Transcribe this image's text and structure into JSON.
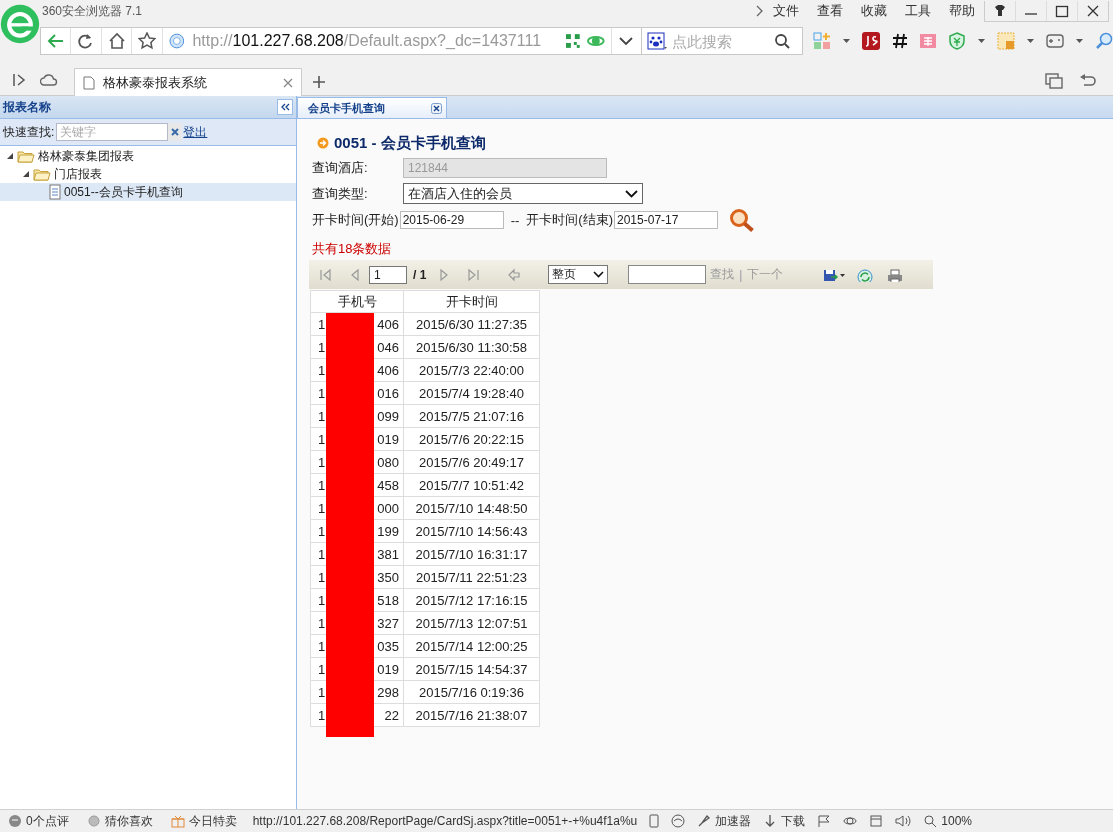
{
  "browser": {
    "title": "360安全浏览器 7.1",
    "menu": [
      "文件",
      "查看",
      "收藏",
      "工具",
      "帮助"
    ],
    "address": {
      "scheme": "http://",
      "host": "101.227.68.208",
      "path": "/Default.aspx?_dc=1437111"
    },
    "search": {
      "placeholder": "点此搜索"
    },
    "tabs": [
      {
        "label": "格林豪泰报表系统",
        "selected": true
      }
    ]
  },
  "sidebar": {
    "title": "报表名称",
    "search_label": "快速查找:",
    "search": {
      "placeholder": "关键字"
    },
    "logout": "登出",
    "tree": [
      {
        "label": "格林豪泰集团报表",
        "kind": "folder",
        "expanded": true,
        "selected": false,
        "children": [
          {
            "label": "门店报表",
            "kind": "folder",
            "expanded": true,
            "selected": false,
            "children": [
              {
                "label": "0051--会员卡手机查询",
                "kind": "report",
                "selected": true
              }
            ]
          }
        ]
      }
    ]
  },
  "report_tabs": [
    {
      "label": "会员卡手机查询",
      "selected": true
    }
  ],
  "report": {
    "title": "0051 - 会员卡手机查询",
    "fields": [
      {
        "label": "查询酒店:",
        "kind": "text",
        "value": "121844",
        "disabled": true
      },
      {
        "label": "查询类型:",
        "kind": "select",
        "value": "在酒店入住的会员",
        "disabled": false
      }
    ],
    "date_range": {
      "start_label": "开卡时间(开始)",
      "start": "2015-06-29",
      "separator": "--",
      "end_label": "开卡时间(结束)",
      "end": "2015-07-17"
    },
    "count": "共有18条数据",
    "toolbar": {
      "page": "1",
      "of": "/ 1",
      "page_mode": "整页",
      "find": "查找",
      "separator": "|",
      "next": "下一个"
    },
    "table": {
      "columns": [
        "手机号",
        "开卡时间"
      ],
      "rows": [
        {
          "phone_start": "1",
          "phone_end": "406",
          "time": "2015/6/30 11:27:35"
        },
        {
          "phone_start": "1",
          "phone_end": "046",
          "time": "2015/6/30 11:30:58"
        },
        {
          "phone_start": "1",
          "phone_end": "406",
          "time": "2015/7/3 22:40:00"
        },
        {
          "phone_start": "1",
          "phone_end": "016",
          "time": "2015/7/4 19:28:40"
        },
        {
          "phone_start": "1",
          "phone_end": "099",
          "time": "2015/7/5 21:07:16"
        },
        {
          "phone_start": "1",
          "phone_end": "019",
          "time": "2015/7/6 20:22:15"
        },
        {
          "phone_start": "1",
          "phone_end": "080",
          "time": "2015/7/6 20:49:17"
        },
        {
          "phone_start": "1",
          "phone_end": "458",
          "time": "2015/7/7 10:51:42"
        },
        {
          "phone_start": "1",
          "phone_end": "000",
          "time": "2015/7/10 14:48:50"
        },
        {
          "phone_start": "1",
          "phone_end": "199",
          "time": "2015/7/10 14:56:43"
        },
        {
          "phone_start": "1",
          "phone_end": "381",
          "time": "2015/7/10 16:31:17"
        },
        {
          "phone_start": "1",
          "phone_end": "350",
          "time": "2015/7/11 22:51:23"
        },
        {
          "phone_start": "1",
          "phone_end": "518",
          "time": "2015/7/12 17:16:15"
        },
        {
          "phone_start": "1",
          "phone_end": "327",
          "time": "2015/7/13 12:07:51"
        },
        {
          "phone_start": "1",
          "phone_end": "035",
          "time": "2015/7/14 12:00:25"
        },
        {
          "phone_start": "1",
          "phone_end": "019",
          "time": "2015/7/15 14:54:37"
        },
        {
          "phone_start": "1",
          "phone_end": "298",
          "time": "2015/7/16 0:19:36"
        },
        {
          "phone_start": "1",
          "phone_end": "22",
          "time": "2015/7/16 21:38:07"
        }
      ]
    }
  },
  "status_bar": {
    "items": [
      {
        "kind": "review",
        "label": "0个点评"
      },
      {
        "kind": "guess",
        "label": "猜你喜欢"
      },
      {
        "kind": "sale",
        "label": "今日特卖"
      }
    ],
    "url": "http://101.227.68.208/ReportPage/CardSj.aspx?title=0051+-+%u4f1a%u",
    "tools": [
      {
        "kind": "accelerator",
        "label": "加速器"
      },
      {
        "kind": "download",
        "label": "下载"
      }
    ],
    "zoom": "100%"
  }
}
